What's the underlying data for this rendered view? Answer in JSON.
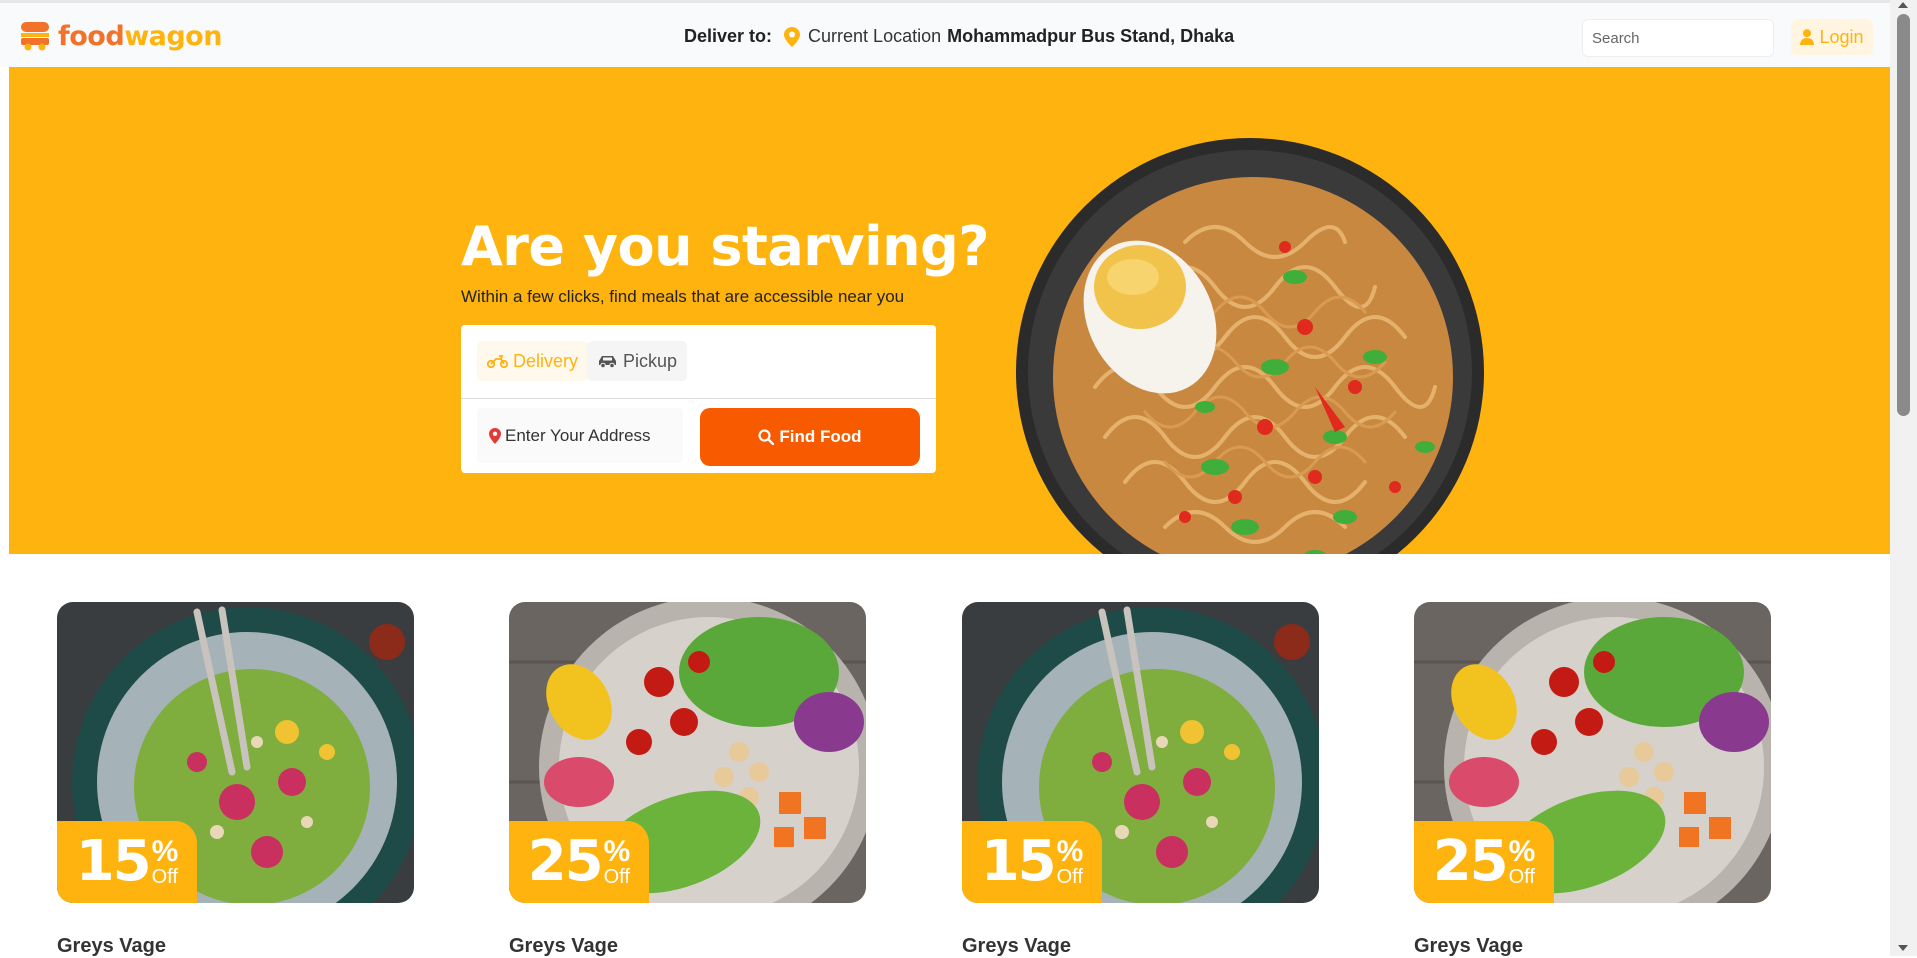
{
  "header": {
    "logo": {
      "food": "food",
      "wagon": "wagon"
    },
    "deliver_label": "Deliver to:",
    "current_location": "Current Location",
    "address": "Mohammadpur Bus Stand, Dhaka",
    "search_placeholder": "Search",
    "login_label": "Login"
  },
  "hero": {
    "title": "Are you starving?",
    "subtitle": "Within a few clicks, find meals that are accessible near you",
    "tabs": [
      {
        "label": "Delivery",
        "icon": "motorbike-icon",
        "active": true
      },
      {
        "label": "Pickup",
        "icon": "car-icon",
        "active": false
      }
    ],
    "address_placeholder": "Enter Your Address",
    "find_button": "Find Food",
    "image": "noodle-bowl-with-egg"
  },
  "deals": [
    {
      "discount": "15",
      "percent": "%",
      "off": "Off",
      "name": "Greys Vage",
      "image": "green-salad-bowl"
    },
    {
      "discount": "25",
      "percent": "%",
      "off": "Off",
      "name": "Greys Vage",
      "image": "vegetable-salad-plate"
    },
    {
      "discount": "15",
      "percent": "%",
      "off": "Off",
      "name": "Greys Vage",
      "image": "green-salad-bowl"
    },
    {
      "discount": "25",
      "percent": "%",
      "off": "Off",
      "name": "Greys Vage",
      "image": "vegetable-salad-plate"
    }
  ],
  "colors": {
    "brand_yellow": "#ffb30e",
    "brand_orange": "#f17228",
    "button_orange": "#f85a00"
  }
}
